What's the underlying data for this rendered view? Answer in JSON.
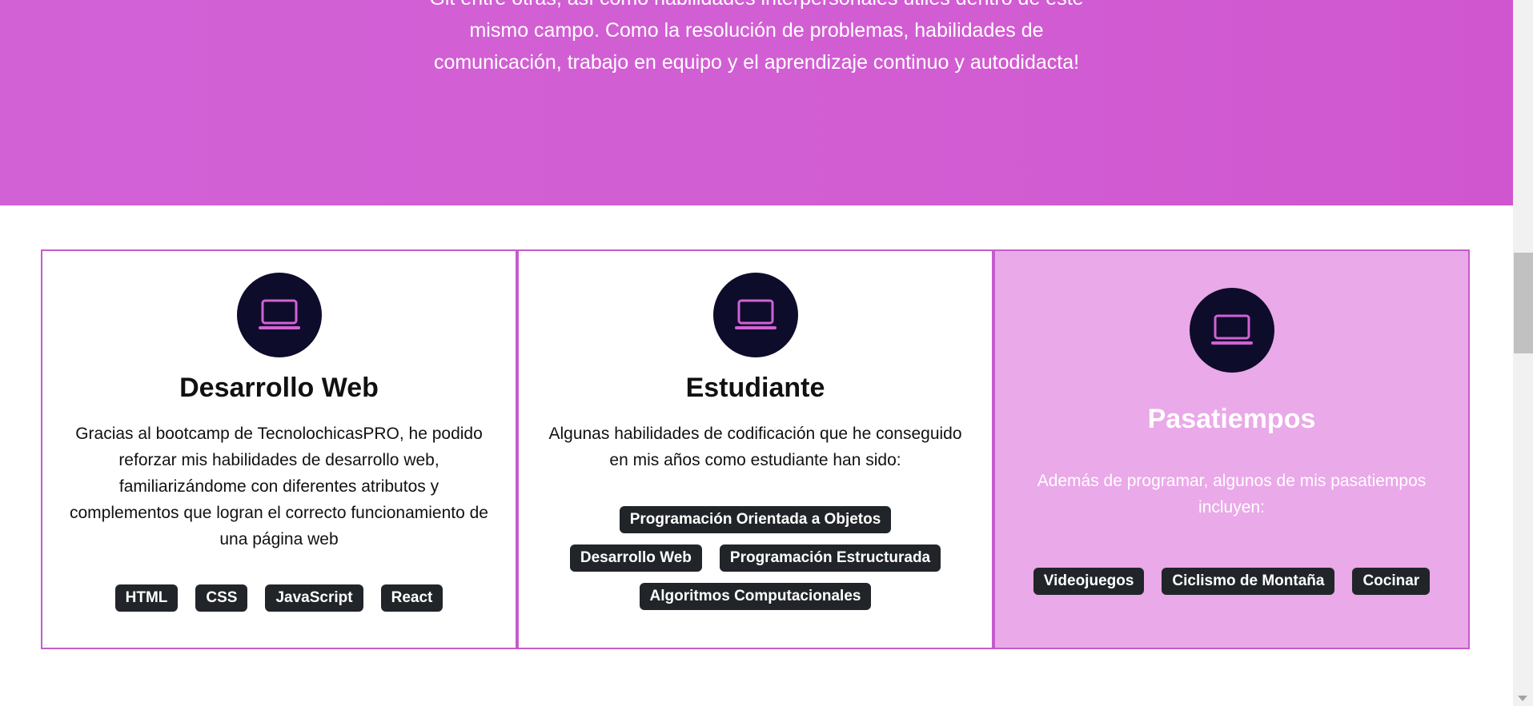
{
  "hero": {
    "text": "Git entre otras, así como habilidades interpersonales útiles dentro de este mismo campo. Como la resolución de problemas, habilidades de comunicación, trabajo en equipo y el aprendizaje continuo y autodidacta!"
  },
  "colors": {
    "hero_bg": "#d25dd3",
    "card_border": "#c45ccb",
    "icon_bg": "#0e0c2b",
    "icon_stroke": "#d262d4",
    "highlight_card_bg": "#eaa9e8",
    "tag_bg": "#212529"
  },
  "cards": [
    {
      "icon": "laptop-icon",
      "title": "Desarrollo Web",
      "text": "Gracias al bootcamp de TecnolochicasPRO, he podido reforzar mis habilidades de desarrollo web, familiarizándome con diferentes atributos y complementos que logran el correcto funcionamiento de una página web",
      "tags": [
        "HTML",
        "CSS",
        "JavaScript",
        "React"
      ]
    },
    {
      "icon": "laptop-icon",
      "title": "Estudiante",
      "text": "Algunas habilidades de codificación que he conseguido en mis años como estudiante han sido:",
      "tags": [
        "Programación Orientada a Objetos",
        "Desarrollo Web",
        "Programación Estructurada",
        "Algoritmos Computacionales"
      ]
    },
    {
      "icon": "laptop-icon",
      "title": "Pasatiempos",
      "text": "Además de programar, algunos de mis pasatiempos incluyen:",
      "tags": [
        "Videojuegos",
        "Ciclismo de Montaña",
        "Cocinar"
      ]
    }
  ]
}
